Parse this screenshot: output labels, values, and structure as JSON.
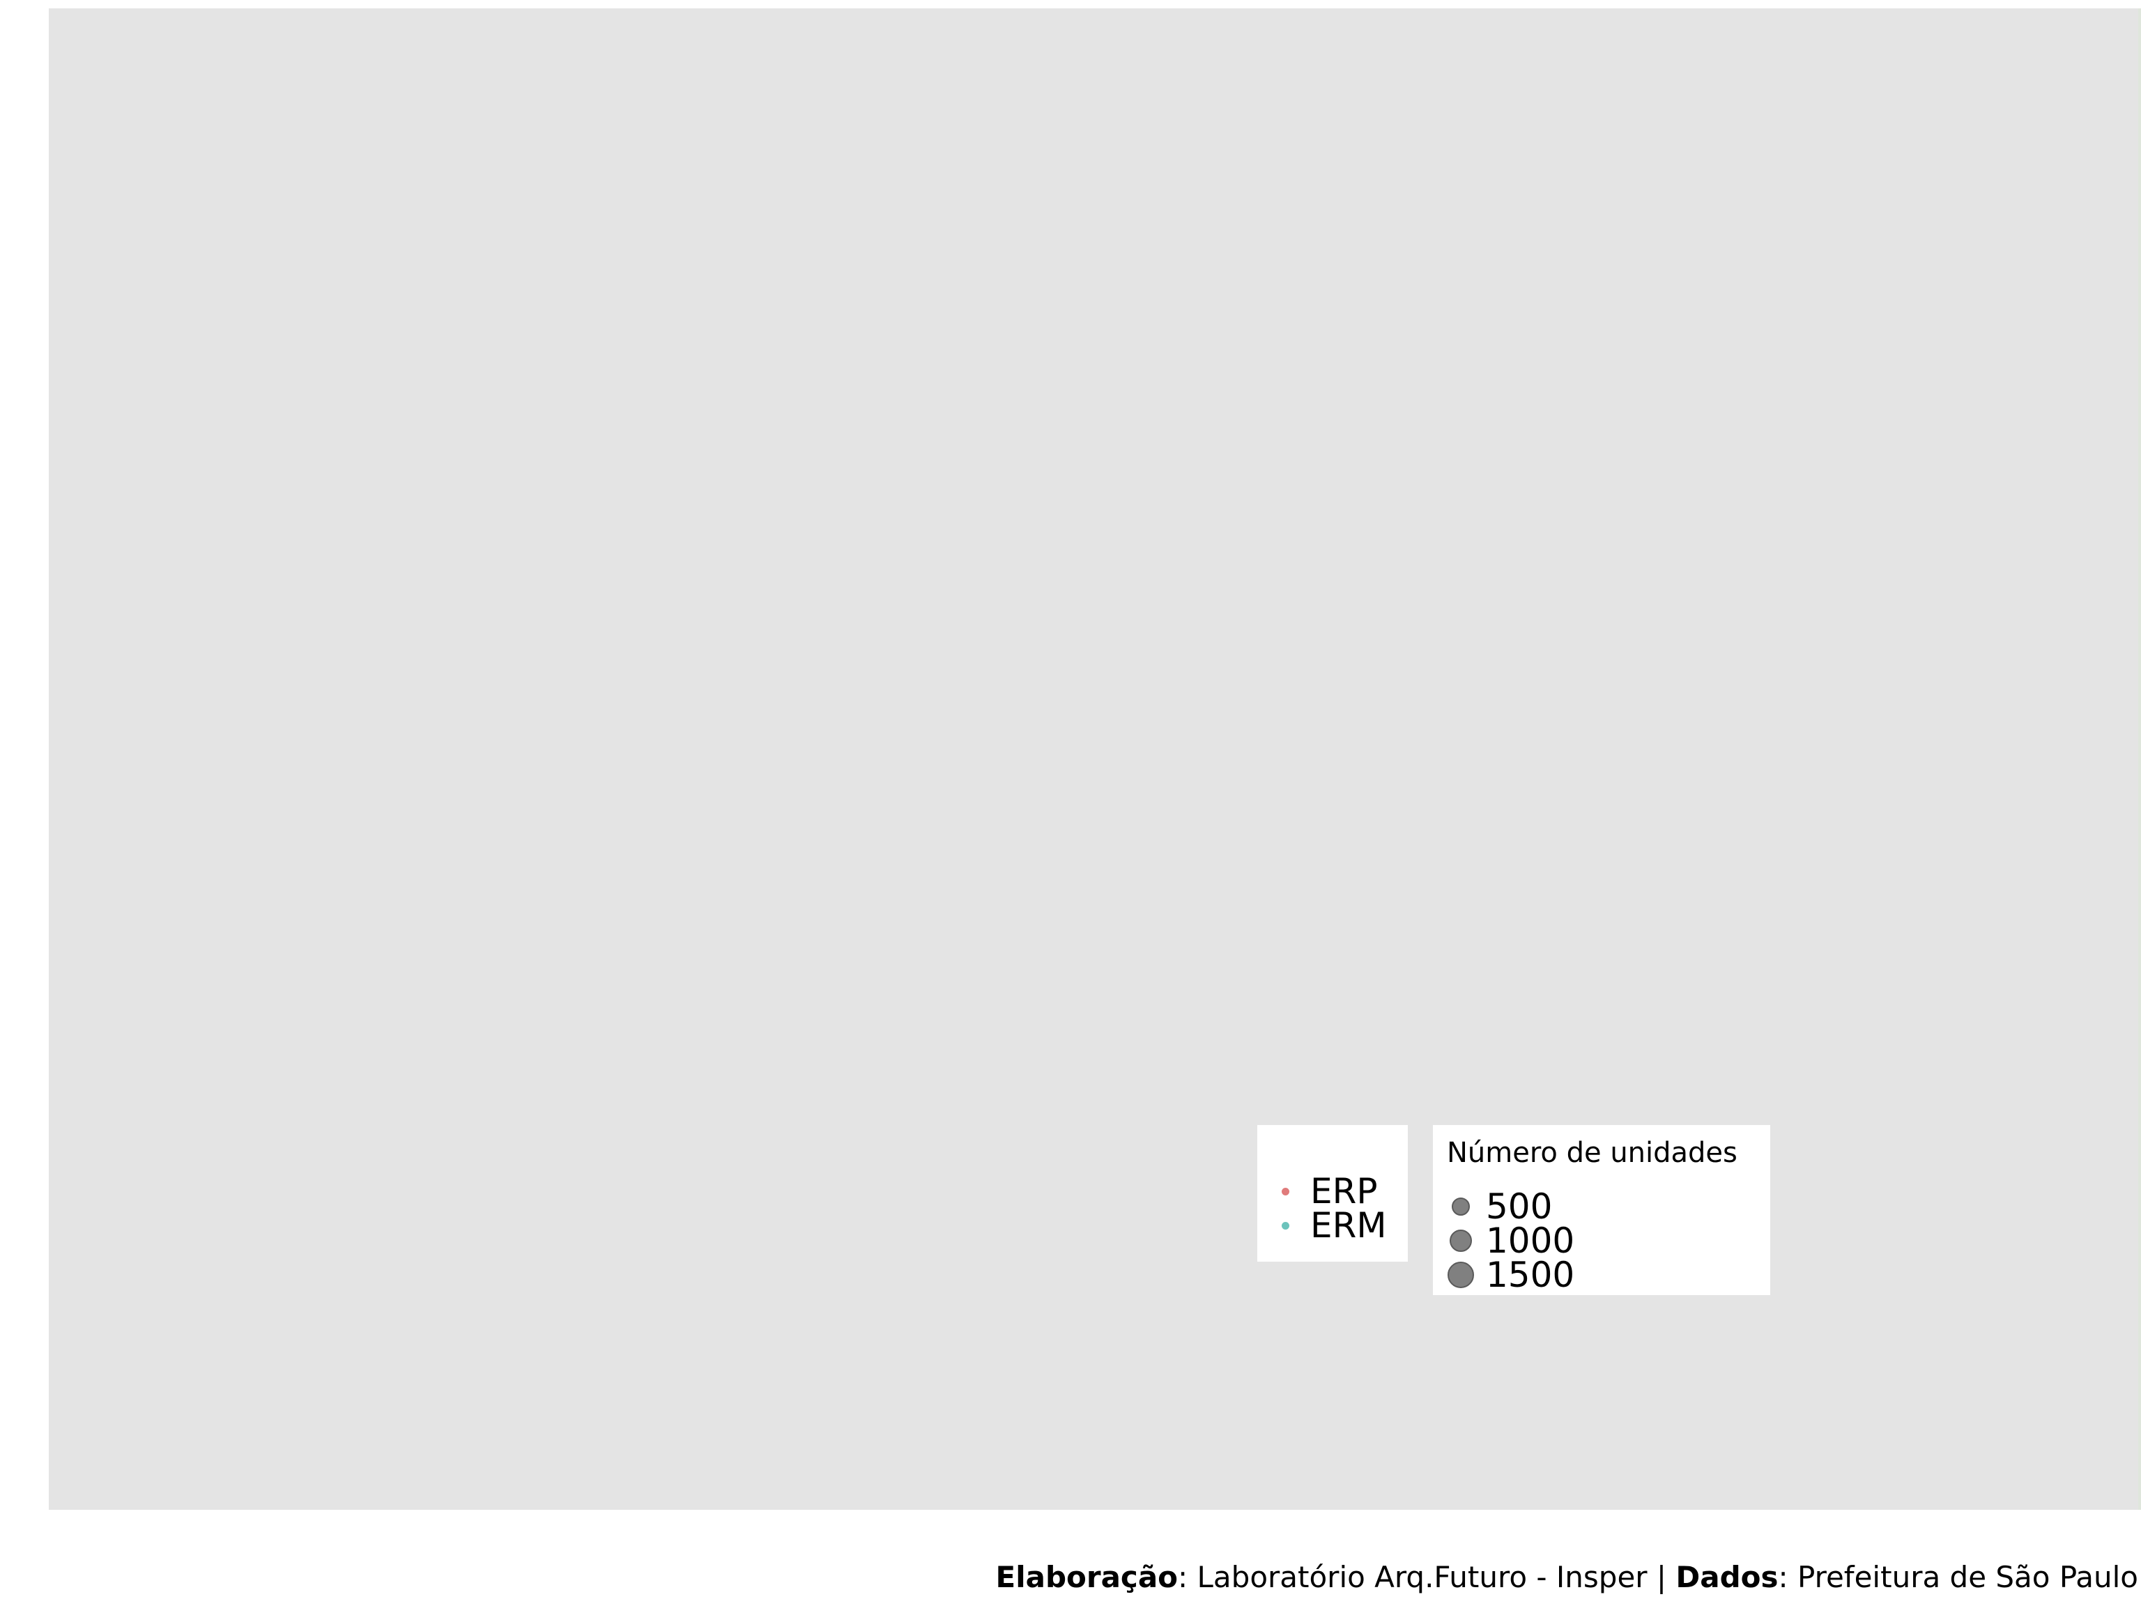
{
  "map": {
    "background_color": "#e4e4e4"
  },
  "legend_type": {
    "items": [
      {
        "label": "ERP",
        "color": "#e07b7b"
      },
      {
        "label": "ERM",
        "color": "#6cc3bc"
      }
    ]
  },
  "legend_size": {
    "title": "Número de unidades",
    "items": [
      {
        "label": "500",
        "value": 500
      },
      {
        "label": "1000",
        "value": 1000
      },
      {
        "label": "1500",
        "value": 1500
      }
    ],
    "color": "#808080"
  },
  "caption": {
    "elaboracao_label": "Elaboração",
    "elaboracao_value": ": Laboratório Arq.Futuro - Insper | ",
    "dados_label": "Dados",
    "dados_value": ": Prefeitura de São Paulo"
  }
}
